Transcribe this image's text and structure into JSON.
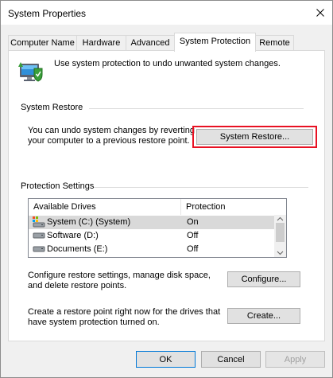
{
  "window": {
    "title": "System Properties"
  },
  "tabs": [
    {
      "label": "Computer Name"
    },
    {
      "label": "Hardware"
    },
    {
      "label": "Advanced"
    },
    {
      "label": "System Protection",
      "active": true
    },
    {
      "label": "Remote"
    }
  ],
  "intro": {
    "text": "Use system protection to undo unwanted system changes."
  },
  "system_restore": {
    "heading": "System Restore",
    "description_line1": "You can undo system changes by reverting",
    "description_line2": "your computer to a previous restore point.",
    "button_label": "System Restore..."
  },
  "protection_settings": {
    "heading": "Protection Settings",
    "columns": [
      "Available Drives",
      "Protection"
    ],
    "drives": [
      {
        "name": "System (C:) (System)",
        "protection": "On",
        "icon": "system-drive-icon"
      },
      {
        "name": "Software (D:)",
        "protection": "Off",
        "icon": "drive-icon"
      },
      {
        "name": "Documents (E:)",
        "protection": "Off",
        "icon": "drive-icon"
      }
    ]
  },
  "configure": {
    "line1": "Configure restore settings, manage disk space,",
    "line2": "and delete restore points.",
    "button_label": "Configure..."
  },
  "create": {
    "line1": "Create a restore point right now for the drives that",
    "line2": "have system protection turned on.",
    "button_label": "Create..."
  },
  "footer": {
    "ok_label": "OK",
    "cancel_label": "Cancel",
    "apply_label": "Apply"
  },
  "colors": {
    "highlight_border": "#e81123",
    "focus_border": "#0078d7"
  }
}
